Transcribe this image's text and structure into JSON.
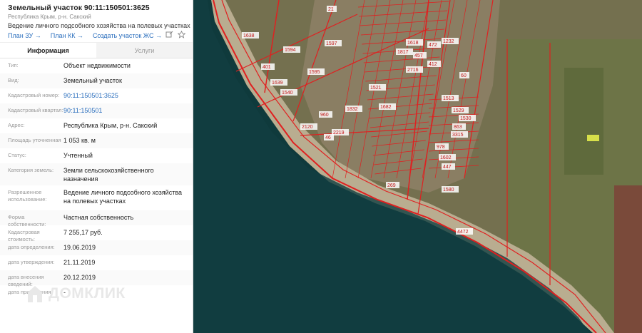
{
  "panel": {
    "title": "Земельный участок 90:11:150501:3625",
    "region": "Республика Крым, р-н. Сакский",
    "purpose": "Ведение личного подсобного хозяйства на полевых участках",
    "links": [
      {
        "label": "План ЗУ →"
      },
      {
        "label": "План КК →"
      },
      {
        "label": "Создать участок ЖС →"
      }
    ],
    "tabs": [
      {
        "label": "Информация",
        "active": true
      },
      {
        "label": "Услуги",
        "active": false
      }
    ],
    "rows": [
      {
        "key": "Тип:",
        "value": "Объект недвижимости",
        "style": ""
      },
      {
        "key": "Вид:",
        "value": "Земельный участок",
        "style": ""
      },
      {
        "key": "Кадастровый номер:",
        "value": "90:11:150501:3625",
        "style": "link"
      },
      {
        "key": "Кадастровый квартал:",
        "value": "90:11:150501",
        "style": "link"
      },
      {
        "key": "Адрес:",
        "value": "Республика Крым, р-н. Сакский",
        "style": ""
      },
      {
        "key": "Площадь уточненная",
        "value": "1 053 кв. м",
        "style": ""
      },
      {
        "key": "Статус:",
        "value": "Учтенный",
        "style": ""
      },
      {
        "key": "Категория земель:",
        "value": "Земли сельскохозяйственного назначения",
        "style": ""
      },
      {
        "key": "Разрешенное использование:",
        "value": "Ведение личного подсобного хозяйства на полевых участках",
        "style": ""
      },
      {
        "key": "Форма собственности:",
        "value": "Частная собственность",
        "style": ""
      },
      {
        "key": "Кадастровая стоимость:",
        "value": "7 255,17 руб.",
        "style": ""
      },
      {
        "key": "дата определения:",
        "value": "19.06.2019",
        "style": ""
      },
      {
        "key": "дата утверждения:",
        "value": "21.11.2019",
        "style": ""
      },
      {
        "key": "дата внесения сведений:",
        "value": "20.12.2019",
        "style": ""
      },
      {
        "key": "дата применения:",
        "value": "-",
        "style": ""
      }
    ],
    "watermark": "ДОМКЛИК"
  },
  "map": {
    "parcel_labels": [
      "21",
      "1638",
      "1597",
      "1594",
      "401",
      "1595",
      "1639",
      "1540",
      "2120",
      "1832",
      "2219",
      "1682",
      "960",
      "1529",
      "1530",
      "978",
      "863",
      "3315",
      "1602",
      "447",
      "1580",
      "269",
      "4472",
      "457",
      "2716",
      "1817",
      "1618",
      "472",
      "412",
      "1521",
      "1513",
      "1232",
      "46",
      "60"
    ],
    "colors": {
      "sea": "#0f3a3c",
      "beach": "#b7a98a",
      "land": "#7d7555",
      "parcel_line": "#e02020",
      "highlight": "#d7e04a"
    }
  }
}
